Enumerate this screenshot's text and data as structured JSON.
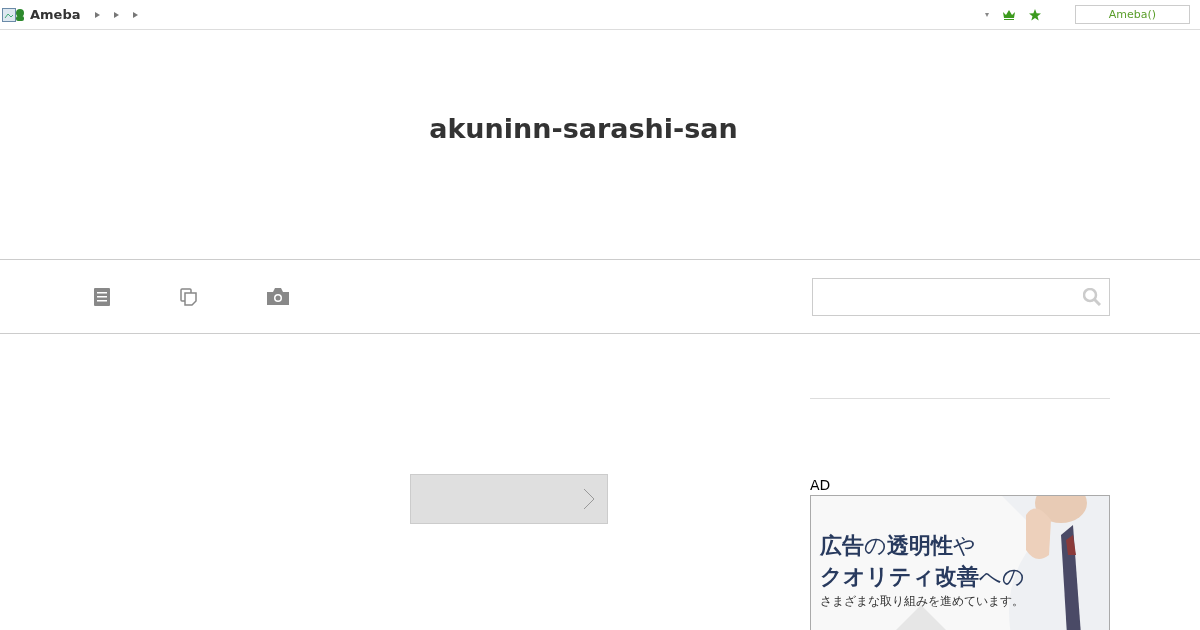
{
  "header": {
    "logo": "Ameba",
    "dropdown": "▾",
    "account_button": "Ameba()"
  },
  "blog": {
    "title": "akuninn-sarashi-san"
  },
  "ad": {
    "label": "AD",
    "lines": [
      "**広告**の**透明性**や",
      "**クオリティ改善**への",
      "さまざまな取り組みを進めています。"
    ]
  }
}
